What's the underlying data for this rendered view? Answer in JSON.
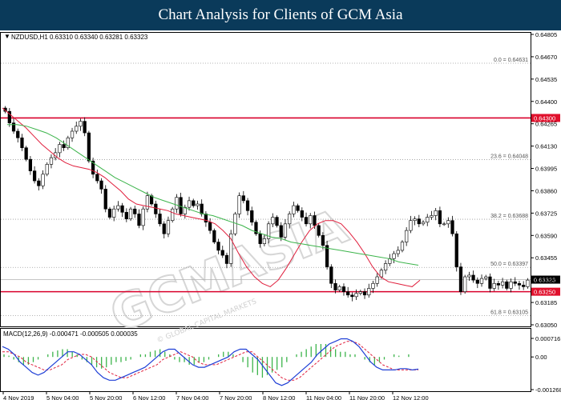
{
  "header": {
    "title": "Chart Analysis for Clients of GCM Asia"
  },
  "watermark": {
    "brand": "GCMASIA",
    "subtitle": "© GLOBAL CAPITAL MARKETS"
  },
  "colors": {
    "bull": "#000000",
    "bear": "#000000",
    "ma_fast": "#e01e3c",
    "ma_slow": "#3cb44b",
    "support_resistance": "#d9002b",
    "macd_hist": "#3cb44b",
    "macd_signal": "#e01e3c",
    "macd_main": "#1f3fd6",
    "price_tag_bg": "#e0102c"
  },
  "chart_data": [
    {
      "type": "candlestick",
      "symbol_label": "NZDUSD,H1  0.63310 0.63340 0.63281 0.63323",
      "ylim": [
        0.6305,
        0.64805
      ],
      "y_ticks": [
        0.64805,
        0.6467,
        0.64535,
        0.644,
        0.64265,
        0.6413,
        0.63995,
        0.6386,
        0.63725,
        0.6359,
        0.63455,
        0.6332,
        0.63185,
        0.6305
      ],
      "y_tick_labels": [
        "0.64805",
        "0.64670",
        "0.64535",
        "0.64400",
        "0.64265",
        "0.64130",
        "0.63995",
        "0.63860",
        "0.63725",
        "0.63590",
        "0.63455",
        "0.63320",
        "0.63185",
        "0.63050"
      ],
      "current_price": 0.63323,
      "current_price_label": "0.63323",
      "horizontal_lines": [
        {
          "value": 0.643,
          "label": "0.64300"
        },
        {
          "value": 0.6325,
          "label": "0.63250"
        }
      ],
      "fib_levels": [
        {
          "label": "0.0 = 0.64631",
          "value": 0.64631
        },
        {
          "label": "23.6 = 0.64048",
          "value": 0.64048
        },
        {
          "label": "38.2 = 0.63688",
          "value": 0.63688
        },
        {
          "label": "50.0 = 0.63397",
          "value": 0.63397
        },
        {
          "label": "61.8 = 0.63105",
          "value": 0.63105
        }
      ],
      "x_tick_labels": [
        "4 Nov 2019",
        "5 Nov 04:00",
        "5 Nov 20:00",
        "6 Nov 12:00",
        "7 Nov 04:00",
        "7 Nov 20:00",
        "8 Nov 12:00",
        "11 Nov 04:00",
        "11 Nov 20:00",
        "12 Nov 12:00"
      ],
      "close_path": [
        0.6434,
        0.6427,
        0.6422,
        0.6418,
        0.6412,
        0.6405,
        0.6398,
        0.6392,
        0.6389,
        0.6396,
        0.6402,
        0.6406,
        0.6409,
        0.6414,
        0.6412,
        0.6418,
        0.6422,
        0.6425,
        0.6428,
        0.6421,
        0.6404,
        0.6396,
        0.6392,
        0.6387,
        0.6375,
        0.637,
        0.6375,
        0.6377,
        0.6373,
        0.6369,
        0.6375,
        0.6372,
        0.6365,
        0.6375,
        0.6383,
        0.6378,
        0.6372,
        0.6366,
        0.636,
        0.6368,
        0.6375,
        0.6382,
        0.6372,
        0.6376,
        0.638,
        0.6377,
        0.6378,
        0.6372,
        0.6367,
        0.6362,
        0.6355,
        0.635,
        0.6347,
        0.6342,
        0.636,
        0.6372,
        0.6383,
        0.638,
        0.6374,
        0.6367,
        0.636,
        0.6354,
        0.6357,
        0.6366,
        0.637,
        0.6365,
        0.6358,
        0.6366,
        0.6372,
        0.6377,
        0.6374,
        0.637,
        0.6366,
        0.6371,
        0.6365,
        0.6359,
        0.6353,
        0.634,
        0.633,
        0.6326,
        0.6328,
        0.6325,
        0.6323,
        0.6322,
        0.6324,
        0.6325,
        0.6323,
        0.6327,
        0.633,
        0.6334,
        0.6338,
        0.6342,
        0.6345,
        0.6348,
        0.635,
        0.6355,
        0.6362,
        0.6368,
        0.6369,
        0.6366,
        0.6367,
        0.637,
        0.6371,
        0.6374,
        0.6366,
        0.6366,
        0.6368,
        0.636,
        0.634,
        0.6325,
        0.6334,
        0.6335,
        0.6332,
        0.633,
        0.6333,
        0.6334,
        0.6327,
        0.633,
        0.6329,
        0.6331,
        0.6327,
        0.6331,
        0.633,
        0.6329,
        0.6328,
        0.6332
      ],
      "ma_fast": [
        0.6436,
        0.6432,
        0.6428,
        0.6424,
        0.6419,
        0.6414,
        0.641,
        0.6406,
        0.6403,
        0.6401,
        0.64,
        0.6399,
        0.6397,
        0.6394,
        0.639,
        0.6386,
        0.6381,
        0.6378,
        0.6377,
        0.6376,
        0.6375,
        0.6374,
        0.6372,
        0.6371,
        0.637,
        0.6369,
        0.6368,
        0.6366,
        0.6362,
        0.6357,
        0.6348,
        0.634,
        0.6334,
        0.633,
        0.6328,
        0.6332,
        0.6339,
        0.6347,
        0.6355,
        0.6362,
        0.6366,
        0.6368,
        0.6368,
        0.6366,
        0.6361,
        0.6355,
        0.6348,
        0.634,
        0.6334,
        0.6331,
        0.633,
        0.6329,
        0.6328,
        0.6332
      ],
      "ma_slow": [
        0.6426,
        0.6426,
        0.6425,
        0.6423,
        0.6421,
        0.6418,
        0.6414,
        0.641,
        0.6406,
        0.6402,
        0.6398,
        0.6394,
        0.6391,
        0.6388,
        0.6385,
        0.6382,
        0.638,
        0.6378,
        0.6376,
        0.6374,
        0.6372,
        0.6371,
        0.6369,
        0.6367,
        0.6365,
        0.6362,
        0.636,
        0.6358,
        0.6357,
        0.6355,
        0.6354,
        0.6353,
        0.6352,
        0.6351,
        0.635,
        0.6349,
        0.6348,
        0.6347,
        0.6346,
        0.6345,
        0.6343,
        0.6342,
        0.6341
      ],
      "macd_label": "MACD(12,26,9) -0.000471 -0.000505 0.000035",
      "macd_ylim": [
        -0.00126,
        0.000716
      ],
      "macd_ticks": [
        0.000716,
        0.0,
        -0.00126
      ],
      "macd_tick_labels": [
        "0.000716",
        "0.00",
        "-0.001268"
      ],
      "macd_hist": [
        0.0001,
        5e-05,
        -0.0001,
        -0.0002,
        -0.0003,
        -0.0003,
        -0.0002,
        -0.0001,
        0.0,
        0.0001,
        0.0002,
        0.00025,
        0.0003,
        0.0003,
        0.0002,
        0.0001,
        -0.0001,
        -0.0002,
        -0.0003,
        -0.0004,
        -0.00045,
        -0.0004,
        -0.0003,
        -0.0002,
        -0.0002,
        -0.00015,
        -0.0001,
        0.0,
        0.0001,
        0.0001,
        0.0002,
        0.00025,
        0.0003,
        0.0002,
        0.0001,
        -0.0001,
        -0.0002,
        -0.0002,
        -0.0003,
        -0.0003,
        -0.0002,
        -0.0002,
        -0.0001,
        0.0,
        0.0001,
        0.0002,
        0.0002,
        0.0001,
        0.0,
        -0.0002,
        -0.0004,
        -0.0006,
        -0.0007,
        -0.0008,
        -0.0007,
        -0.0006,
        -0.0005,
        -0.0004,
        -0.0002,
        0.0,
        0.0001,
        0.0002,
        0.0003,
        0.0004,
        0.0005,
        0.0005,
        0.0005,
        0.0004,
        0.0003,
        0.0002,
        0.0002,
        0.0001,
        0.0001,
        0.0,
        -0.0001,
        -0.0002,
        -0.0003,
        -0.0002,
        -0.0001,
        0.0,
        0.0001,
        5e-05,
        0.0,
        0.0001
      ],
      "macd_main": [
        0.0004,
        0.0003,
        0.0001,
        -0.0002,
        -0.0004,
        -0.0006,
        -0.0007,
        -0.0006,
        -0.0004,
        -0.0002,
        0.0,
        0.0002,
        0.0002,
        0.0001,
        -0.0001,
        -0.0003,
        -0.0006,
        -0.0008,
        -0.0009,
        -0.0009,
        -0.0008,
        -0.0007,
        -0.0006,
        -0.0005,
        -0.0004,
        -0.0002,
        0.0,
        0.0002,
        0.0003,
        0.0003,
        0.0001,
        -0.0001,
        -0.0003,
        -0.0004,
        -0.0004,
        -0.0003,
        -0.0002,
        -0.0001,
        0.0,
        0.0002,
        0.0003,
        0.0003,
        0.0001,
        -0.0001,
        -0.0004,
        -0.0007,
        -0.001,
        -0.0011,
        -0.001,
        -0.0008,
        -0.0006,
        -0.0004,
        -0.0002,
        0.0001,
        0.0003,
        0.0005,
        0.0006,
        0.0007,
        0.0007,
        0.0006,
        0.0004,
        0.0001,
        -0.0002,
        -0.0004,
        -0.0005,
        -0.0005,
        -0.0005,
        -0.00045,
        -0.00045,
        -0.0005,
        -0.00047
      ],
      "macd_signal": [
        0.0002,
        0.0002,
        0.0001,
        0.0,
        -0.0002,
        -0.0003,
        -0.0004,
        -0.0005,
        -0.0005,
        -0.0004,
        -0.0003,
        -0.0001,
        0.0,
        0.0001,
        0.0001,
        0.0,
        -0.0002,
        -0.0004,
        -0.0006,
        -0.0007,
        -0.0008,
        -0.0008,
        -0.0007,
        -0.0006,
        -0.0005,
        -0.0004,
        -0.0003,
        -0.0001,
        0.0,
        0.0001,
        0.0002,
        0.0001,
        0.0,
        -0.0002,
        -0.0003,
        -0.0003,
        -0.0003,
        -0.0002,
        -0.0001,
        0.0,
        0.0001,
        0.0002,
        0.0002,
        0.0,
        -0.0002,
        -0.0004,
        -0.0006,
        -0.0008,
        -0.0009,
        -0.0009,
        -0.0008,
        -0.0006,
        -0.0004,
        -0.0002,
        0.0,
        0.0002,
        0.0004,
        0.0005,
        0.0006,
        0.0006,
        0.0005,
        0.0003,
        0.0001,
        -0.0001,
        -0.0003,
        -0.0004,
        -0.0005,
        -0.0005,
        -0.0005,
        -0.0005,
        -0.0005
      ]
    }
  ]
}
